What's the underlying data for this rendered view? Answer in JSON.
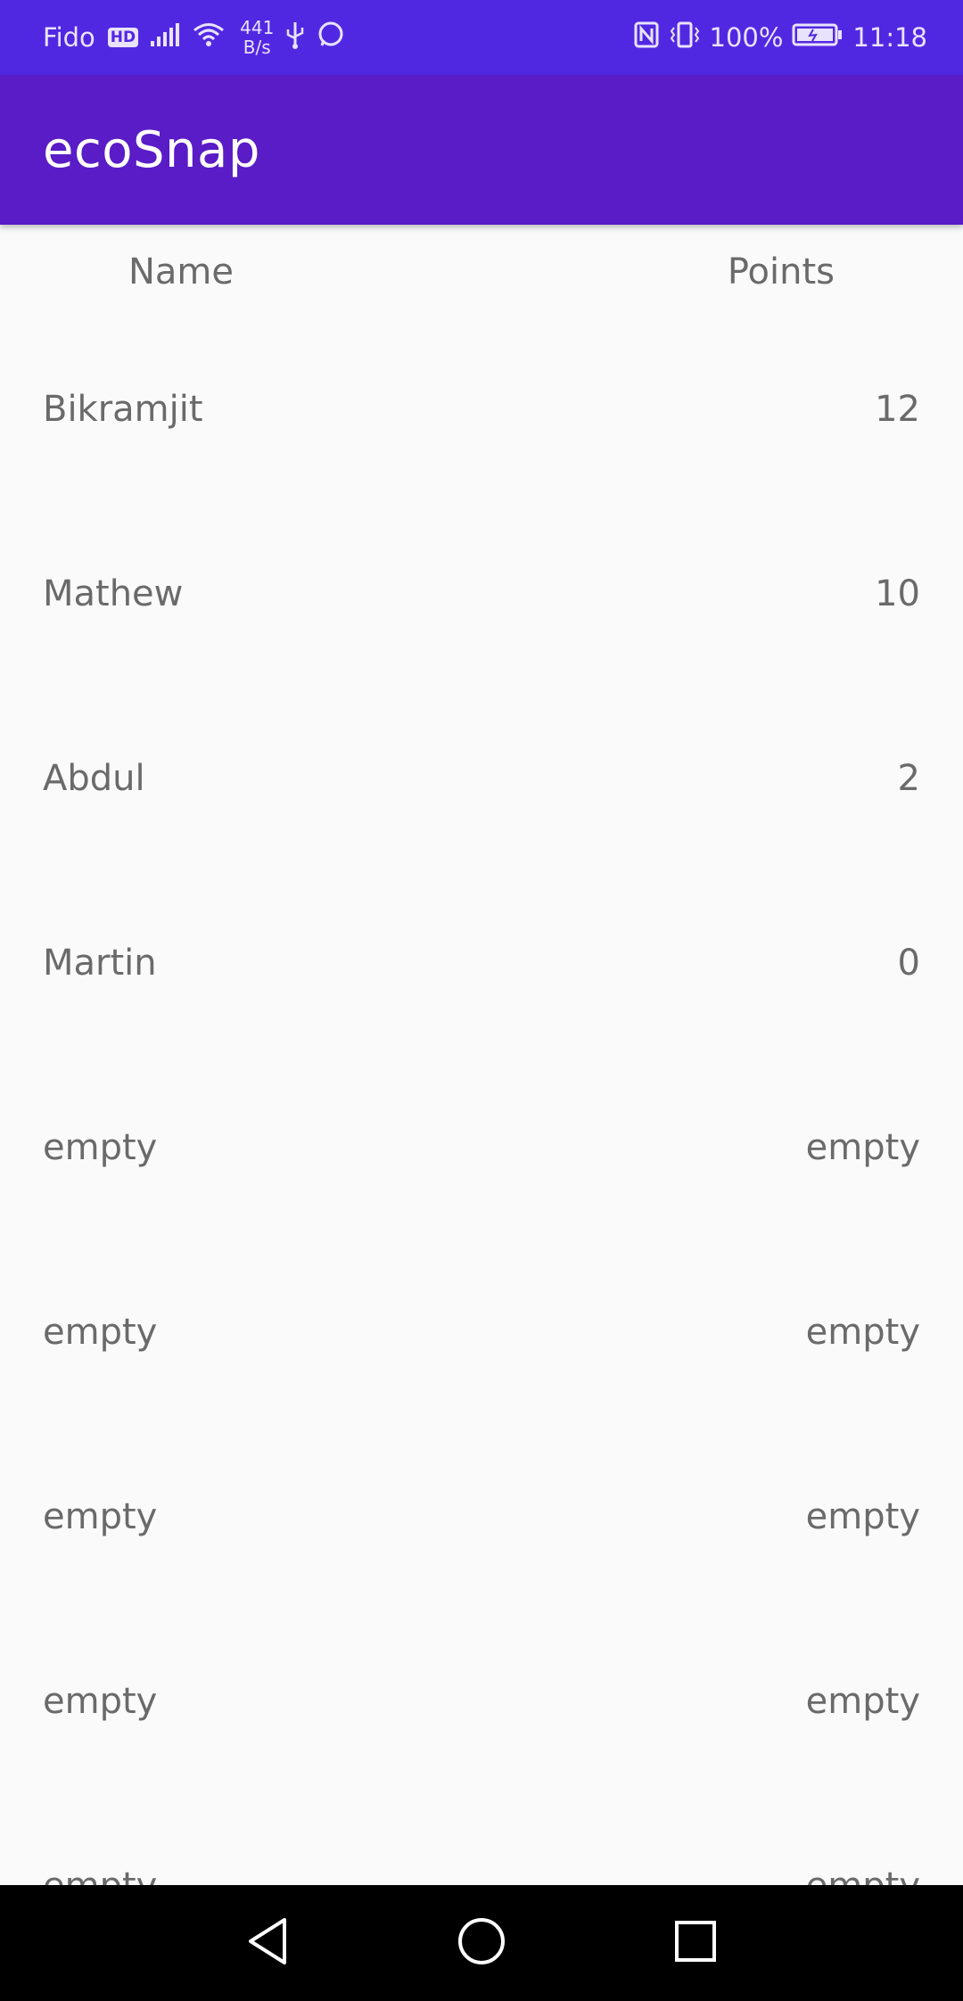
{
  "status_bar": {
    "carrier": "Fido",
    "carrier_badge": "HD",
    "net_speed_value": "441",
    "net_speed_unit": "B/s",
    "battery": "100%",
    "time": "11:18"
  },
  "app_bar": {
    "title": "ecoSnap"
  },
  "table": {
    "headers": {
      "name": "Name",
      "points": "Points"
    },
    "rows": [
      {
        "name": "Bikramjit",
        "points": "12"
      },
      {
        "name": "Mathew",
        "points": "10"
      },
      {
        "name": "Abdul",
        "points": "2"
      },
      {
        "name": "Martin",
        "points": "0"
      },
      {
        "name": "empty",
        "points": "empty"
      },
      {
        "name": "empty",
        "points": "empty"
      },
      {
        "name": "empty",
        "points": "empty"
      },
      {
        "name": "empty",
        "points": "empty"
      },
      {
        "name": "empty",
        "points": "empty"
      }
    ]
  },
  "colors": {
    "status_bar": "#5128e2",
    "app_bar": "#591cc7",
    "background": "#fafafa",
    "text": "#6a6a6a",
    "nav_bar": "#000000"
  },
  "icons": {
    "status": [
      "signal-icon",
      "wifi-icon",
      "usb-icon",
      "whatsapp-icon",
      "nfc-icon",
      "vibrate-icon",
      "battery-icon"
    ],
    "navigation": [
      "back-icon",
      "home-icon",
      "recents-icon"
    ]
  }
}
